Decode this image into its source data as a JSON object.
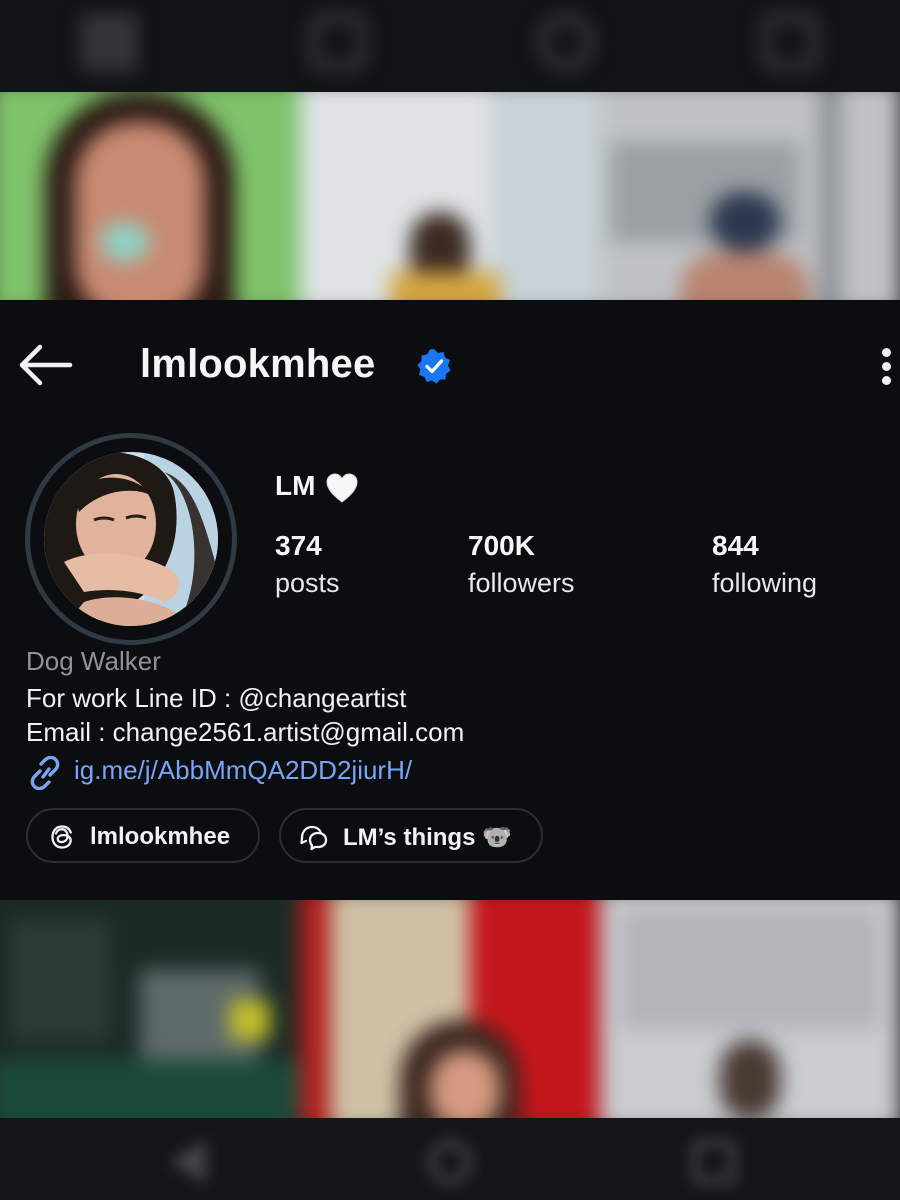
{
  "header": {
    "username": "lmlookmhee",
    "verified": true
  },
  "profile": {
    "display_name": "LM",
    "stats": [
      {
        "value": "374",
        "label": "posts"
      },
      {
        "value": "700K",
        "label": "followers"
      },
      {
        "value": "844",
        "label": "following"
      }
    ],
    "bio": {
      "category": "Dog Walker",
      "line1": "For work Line ID : @changeartist",
      "line2": "Email : change2561.artist@gmail.com",
      "link": "ig.me/j/AbbMmQA2DD2jiurH/"
    },
    "chips": [
      {
        "label": "lmlookmhee",
        "icon": "threads-icon"
      },
      {
        "label": "LM’s things 🐨",
        "icon": "chat-bubbles-icon"
      }
    ]
  },
  "colors": {
    "background": "#0c0d11",
    "verified_badge": "#1877f2",
    "link": "#7aa5f5",
    "category": "#8e949c"
  }
}
